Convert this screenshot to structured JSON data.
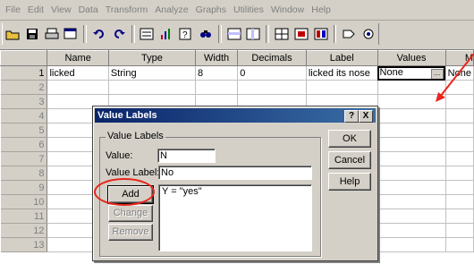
{
  "menu": [
    "File",
    "Edit",
    "View",
    "Data",
    "Transform",
    "Analyze",
    "Graphs",
    "Utilities",
    "Window",
    "Help"
  ],
  "toolbar_icons": [
    "open-icon",
    "save-icon",
    "print-icon",
    "dialog-recall-icon",
    "undo-icon",
    "redo-icon",
    "goto-chart-icon",
    "goto-case-icon",
    "variables-icon",
    "find-icon",
    "insert-cases-icon",
    "insert-variable-icon",
    "split-file-icon",
    "weight-cases-icon",
    "select-cases-icon",
    "value-labels-icon",
    "use-sets-icon"
  ],
  "grid": {
    "columns": [
      "Name",
      "Type",
      "Width",
      "Decimals",
      "Label",
      "Values",
      "M"
    ],
    "rows": [
      {
        "num": "1",
        "cells": [
          "licked",
          "String",
          "8",
          "0",
          "licked its nose",
          "None",
          "None"
        ]
      },
      {
        "num": "2",
        "cells": [
          "",
          "",
          "",
          "",
          "",
          "",
          ""
        ]
      },
      {
        "num": "3",
        "cells": [
          "",
          "",
          "",
          "",
          "",
          "",
          ""
        ]
      },
      {
        "num": "4",
        "cells": [
          "",
          "",
          "",
          "",
          "",
          "",
          ""
        ]
      },
      {
        "num": "5",
        "cells": [
          "",
          "",
          "",
          "",
          "",
          "",
          ""
        ]
      },
      {
        "num": "6",
        "cells": [
          "",
          "",
          "",
          "",
          "",
          "",
          ""
        ]
      },
      {
        "num": "7",
        "cells": [
          "",
          "",
          "",
          "",
          "",
          "",
          ""
        ]
      },
      {
        "num": "8",
        "cells": [
          "",
          "",
          "",
          "",
          "",
          "",
          ""
        ]
      },
      {
        "num": "9",
        "cells": [
          "",
          "",
          "",
          "",
          "",
          "",
          ""
        ]
      },
      {
        "num": "10",
        "cells": [
          "",
          "",
          "",
          "",
          "",
          "",
          ""
        ]
      },
      {
        "num": "11",
        "cells": [
          "",
          "",
          "",
          "",
          "",
          "",
          ""
        ]
      },
      {
        "num": "12",
        "cells": [
          "",
          "",
          "",
          "",
          "",
          "",
          ""
        ]
      },
      {
        "num": "13",
        "cells": [
          "",
          "",
          "",
          "",
          "",
          "",
          ""
        ]
      }
    ]
  },
  "dialog": {
    "title": "Value Labels",
    "help_ctrl": "?",
    "close_ctrl": "X",
    "group_label": "Value Labels",
    "value_label": "Value:",
    "value_input": "N",
    "value_label_label": "Value Label:",
    "value_label_input": "No",
    "list_items": [
      "Y = \"yes\""
    ],
    "buttons": {
      "add": "Add",
      "change": "Change",
      "remove": "Remove",
      "ok": "OK",
      "cancel": "Cancel",
      "help": "Help"
    }
  },
  "colors": {
    "title_bar": "#0a246a",
    "annotation_red": "#e8261c"
  }
}
